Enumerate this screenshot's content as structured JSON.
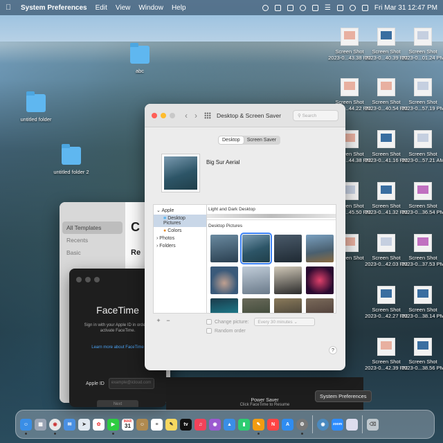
{
  "menubar": {
    "apple": "",
    "app_name": "System Preferences",
    "menus": [
      "Edit",
      "View",
      "Window",
      "Help"
    ],
    "datetime": "Fri Mar 31  12:47 PM"
  },
  "desktop": {
    "folders": [
      {
        "label": "abc"
      },
      {
        "label": "untitled folder"
      },
      {
        "label": "untitled folder 2"
      }
    ],
    "screenshots": [
      {
        "l1": "Screen Shot",
        "l2": "2023-0...43.38 PM"
      },
      {
        "l1": "Screen Shot",
        "l2": "2023-0...40.39 PM"
      },
      {
        "l1": "Screen Shot",
        "l2": "2023-0...01.24 PM"
      },
      {
        "l1": "Screen Shot",
        "l2": "2023-0...44.22 PM"
      },
      {
        "l1": "Screen Shot",
        "l2": "2023-0...40.54 PM"
      },
      {
        "l1": "Screen Shot",
        "l2": "2023-0...57.19 PM"
      },
      {
        "l1": "Screen Shot",
        "l2": "2023-0...44.38 PM"
      },
      {
        "l1": "Screen Shot",
        "l2": "2023-0...41.16 PM"
      },
      {
        "l1": "Screen Shot",
        "l2": "2023-0...57.21 AM"
      },
      {
        "l1": "Screen Shot",
        "l2": "2023-0...45.50 PM"
      },
      {
        "l1": "Screen Shot",
        "l2": "2023-0...41.32 PM"
      },
      {
        "l1": "Screen Shot",
        "l2": "2023-0...36.54 PM"
      },
      {
        "l1": "Screen Shot",
        "l2": ""
      },
      {
        "l1": "Screen Shot",
        "l2": "2023-0...42.03 PM"
      },
      {
        "l1": "Screen Shot",
        "l2": "2023-0...37.53 PM"
      },
      {
        "l1": "Screen Shot",
        "l2": "2023-0...42.27 PM"
      },
      {
        "l1": "Screen Shot",
        "l2": "2023-0...38.14 PM"
      },
      {
        "l1": "Screen Shot",
        "l2": "2023-0...42.39 PM"
      },
      {
        "l1": "Screen Shot",
        "l2": "2023-0...38.56 PM"
      }
    ]
  },
  "pages_window": {
    "sidebar": [
      "All Templates",
      "Recents",
      "Basic"
    ],
    "heading": "C",
    "subheading": "Re"
  },
  "facetime": {
    "title": "FaceTime",
    "subtitle": "Sign in with your Apple ID in order to activate FaceTime.",
    "link": "Learn more about FaceTime",
    "apple_id_label": "Apple ID",
    "apple_id_placeholder": "example@icloud.com",
    "next": "Next"
  },
  "strip": {
    "title": "Power Saver",
    "sub": "Click FaceTime to Resume"
  },
  "sysprefs": {
    "title": "Desktop & Screen Saver",
    "search_placeholder": "Search",
    "tabs": [
      "Desktop",
      "Screen Saver"
    ],
    "current_name": "Big Sur Aerial",
    "sources": {
      "group": "Apple",
      "items": [
        "Desktop Pictures",
        "Colors"
      ],
      "others": [
        "Photos",
        "Folders"
      ]
    },
    "section1": "Light and Dark Desktop",
    "section2": "Desktop Pictures",
    "change_picture_label": "Change picture:",
    "change_picture_value": "Every 30 minutes",
    "random_order_label": "Random order",
    "help": "?",
    "add": "+",
    "remove": "−"
  },
  "tooltip": "System Preferences",
  "dock": {
    "calendar_month": "MAR",
    "calendar_day": "31",
    "appletv": "tv",
    "zoom": "zoom"
  }
}
